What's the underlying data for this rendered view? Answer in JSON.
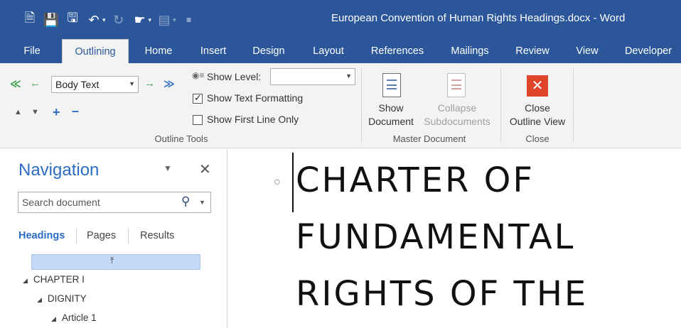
{
  "window": {
    "title": "European Convention of Human Rights Headings.docx  -  Word"
  },
  "qat_icons": [
    "new-document-icon",
    "save-icon",
    "save-as-icon",
    "undo-icon",
    "redo-icon",
    "touch-mode-icon",
    "print-preview-icon",
    "customize-qat-icon"
  ],
  "tabs": [
    {
      "label": "File"
    },
    {
      "label": "Outlining"
    },
    {
      "label": "Home"
    },
    {
      "label": "Insert"
    },
    {
      "label": "Design"
    },
    {
      "label": "Layout"
    },
    {
      "label": "References"
    },
    {
      "label": "Mailings"
    },
    {
      "label": "Review"
    },
    {
      "label": "View"
    },
    {
      "label": "Developer"
    }
  ],
  "active_tab": "Outlining",
  "ribbon": {
    "outline_tools": {
      "level_value": "Body Text",
      "show_level_label": "Show Level:",
      "show_level_value": "",
      "show_text_formatting_label": "Show Text Formatting",
      "show_text_formatting_checked": true,
      "show_first_line_label": "Show First Line Only",
      "show_first_line_checked": false,
      "group_label": "Outline Tools"
    },
    "master_document": {
      "show_document_line1": "Show",
      "show_document_line2": "Document",
      "collapse_line1": "Collapse",
      "collapse_line2": "Subdocuments",
      "group_label": "Master Document"
    },
    "close": {
      "close_line1": "Close",
      "close_line2": "Outline View",
      "group_label": "Close"
    }
  },
  "navigation": {
    "title": "Navigation",
    "search_placeholder": "Search document",
    "tabs": [
      {
        "label": "Headings"
      },
      {
        "label": "Pages"
      },
      {
        "label": "Results"
      }
    ],
    "tree": [
      {
        "label": "CHAPTER I",
        "level": 1
      },
      {
        "label": "DIGNITY",
        "level": 2
      },
      {
        "label": "Article 1",
        "level": 3
      }
    ]
  },
  "document": {
    "lines": [
      "CHARTER OF",
      "FUNDAMENTAL",
      "RIGHTS OF THE"
    ]
  },
  "colors": {
    "word_blue": "#2b579a",
    "ribbon_bg": "#f3f3f3",
    "nav_accent": "#2b6cc4",
    "close_red": "#e0442a"
  }
}
